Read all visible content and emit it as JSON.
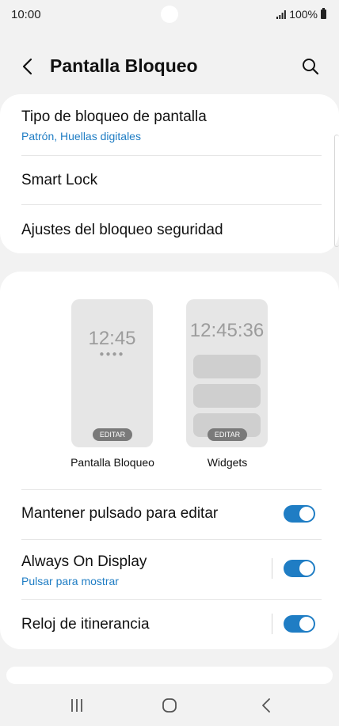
{
  "status": {
    "time": "10:00",
    "battery": "100%"
  },
  "header": {
    "title": "Pantalla Bloqueo"
  },
  "security": {
    "items": [
      {
        "title": "Tipo de bloqueo de pantalla",
        "subtitle": "Patrón, Huellas digitales"
      },
      {
        "title": "Smart Lock"
      },
      {
        "title": "Ajustes del bloqueo seguridad"
      }
    ]
  },
  "previews": {
    "lock": {
      "time": "12:45",
      "dots": "●●●●",
      "edit": "EDITAR",
      "label": "Pantalla Bloqueo"
    },
    "widgets": {
      "time": "12:45:36",
      "edit": "EDITAR",
      "label": "Widgets"
    }
  },
  "toggles": [
    {
      "title": "Mantener pulsado para editar",
      "on": true
    },
    {
      "title": "Always On Display",
      "subtitle": "Pulsar para mostrar",
      "on": true
    },
    {
      "title": "Reloj de itinerancia",
      "on": true
    }
  ],
  "colors": {
    "accent": "#1f7dc4",
    "background": "#f2f2f2",
    "card": "#ffffff"
  },
  "icons": [
    "back-arrow-icon",
    "search-icon",
    "recents-icon",
    "home-icon",
    "nav-back-icon"
  ]
}
